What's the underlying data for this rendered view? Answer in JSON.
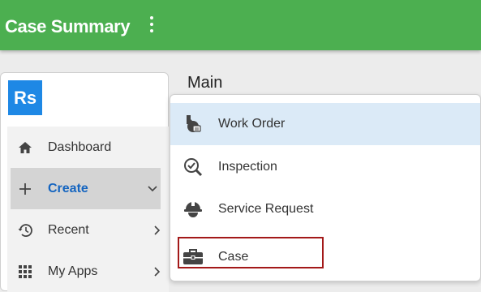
{
  "appbar": {
    "title": "Case Summary",
    "more_icon": "more-vert-icon"
  },
  "logo": {
    "text": "Rs",
    "color": "#1e88e5"
  },
  "sidebar": {
    "items": [
      {
        "label": "Dashboard",
        "icon": "home-icon",
        "chevron": ""
      },
      {
        "label": "Create",
        "icon": "plus-icon",
        "chevron": "chevron-down-icon",
        "active": true
      },
      {
        "label": "Recent",
        "icon": "history-icon",
        "chevron": "chevron-right-icon"
      },
      {
        "label": "My Apps",
        "icon": "apps-grid-icon",
        "chevron": "chevron-right-icon"
      }
    ]
  },
  "main": {
    "heading": "Main"
  },
  "menu": {
    "items": [
      {
        "label": "Work Order",
        "icon": "work-order-icon",
        "highlighted": true
      },
      {
        "label": "Inspection",
        "icon": "inspection-icon"
      },
      {
        "label": "Service Request",
        "icon": "hard-hat-icon"
      },
      {
        "label": "Case",
        "icon": "briefcase-icon",
        "outlined": true
      }
    ]
  },
  "colors": {
    "appbar": "#4caf50",
    "accent": "#1565c0",
    "highlight": "#dbeaf7",
    "outline": "#a31919"
  }
}
